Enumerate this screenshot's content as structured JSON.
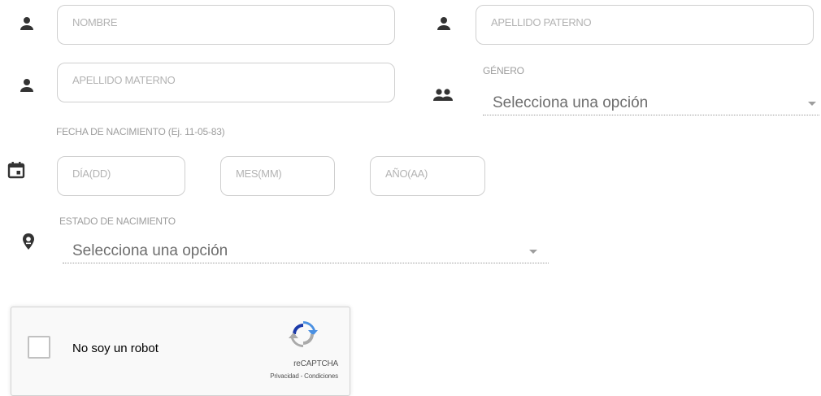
{
  "form": {
    "nombre": {
      "placeholder": "NOMBRE",
      "icon": "person-icon"
    },
    "apellido_paterno": {
      "placeholder": "APELLIDO PATERNO",
      "icon": "person-icon"
    },
    "apellido_materno": {
      "placeholder": "APELLIDO MATERNO",
      "icon": "person-icon"
    },
    "genero": {
      "label": "GÉNERO",
      "value": "Selecciona una opción",
      "icon": "people-icon"
    },
    "fecha_nacimiento": {
      "label": "FECHA DE NACIMIENTO (Ej. 11-05-83)",
      "icon": "calendar-icon",
      "dia": "DÍA(DD)",
      "mes": "MES(MM)",
      "anio": "AÑO(AA)"
    },
    "estado_nacimiento": {
      "label": "ESTADO DE NACIMIENTO",
      "value": "Selecciona una opción",
      "icon": "location-pin-icon"
    }
  },
  "recaptcha": {
    "label": "No soy un robot",
    "brand": "reCAPTCHA",
    "links": "Privacidad - Condiciones"
  },
  "colors": {
    "icon": "#333333",
    "input_border": "#cfcfcf",
    "placeholder": "#b3b3b3",
    "recaptcha_blue": "#4a90e2",
    "recaptcha_gray": "#aaaaaa"
  }
}
